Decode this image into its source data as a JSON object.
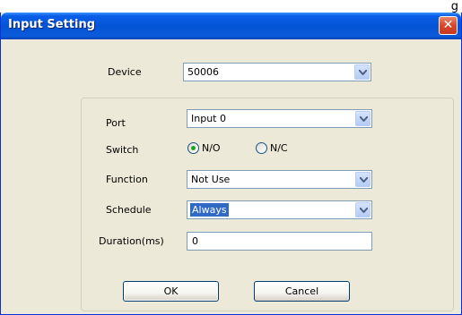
{
  "background_caption": "g",
  "window": {
    "title": "Input Setting",
    "close_glyph": "✕"
  },
  "device": {
    "label": "Device",
    "value": "50006"
  },
  "port": {
    "label": "Port",
    "value": "Input 0"
  },
  "switch": {
    "label": "Switch",
    "options": [
      {
        "label": "N/O",
        "selected": true
      },
      {
        "label": "N/C",
        "selected": false
      }
    ]
  },
  "function": {
    "label": "Function",
    "value": "Not Use"
  },
  "schedule": {
    "label": "Schedule",
    "value": "Always"
  },
  "duration": {
    "label": "Duration(ms)",
    "value": "0"
  },
  "buttons": {
    "ok": "OK",
    "cancel": "Cancel"
  },
  "colors": {
    "titlebar": "#0553d6",
    "dialog_bg": "#ece9d8",
    "selection": "#316ac5"
  }
}
